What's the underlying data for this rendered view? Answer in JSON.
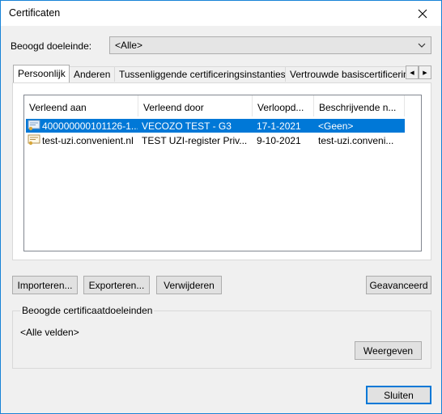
{
  "window": {
    "title": "Certificaten"
  },
  "purpose": {
    "label": "Beoogd doeleinde:",
    "value": "<Alle>"
  },
  "tabs": [
    {
      "label": "Persoonlijk"
    },
    {
      "label": "Anderen"
    },
    {
      "label": "Tussenliggende certificeringsinstanties"
    },
    {
      "label": "Vertrouwde basiscertificeringsinstanties"
    }
  ],
  "list": {
    "columns": [
      "Verleend aan",
      "Verleend door",
      "Verloopd...",
      "Beschrijvende n..."
    ],
    "rows": [
      {
        "issued_to": "400000000101126-1...",
        "issued_by": "VECOZO TEST - G3",
        "expires": "17-1-2021",
        "friendly_name": "<Geen>",
        "selected": true
      },
      {
        "issued_to": "test-uzi.convenient.nl",
        "issued_by": "TEST UZI-register Priv...",
        "expires": "9-10-2021",
        "friendly_name": "test-uzi.conveni...",
        "selected": false
      }
    ]
  },
  "buttons": {
    "import": "Importeren...",
    "export": "Exporteren...",
    "remove": "Verwijderen",
    "advanced": "Geavanceerd",
    "view": "Weergeven",
    "close": "Sluiten"
  },
  "purposes_group": {
    "title": "Beoogde certificaatdoeleinden",
    "value": "<Alle velden>"
  },
  "colors": {
    "accent": "#0078d7",
    "border": "#1883d7"
  },
  "icons": {
    "close": "close-icon",
    "dropdown": "chevron-down-icon",
    "tab_left": "arrow-left-icon",
    "tab_right": "arrow-right-icon",
    "certificate": "certificate-icon"
  }
}
